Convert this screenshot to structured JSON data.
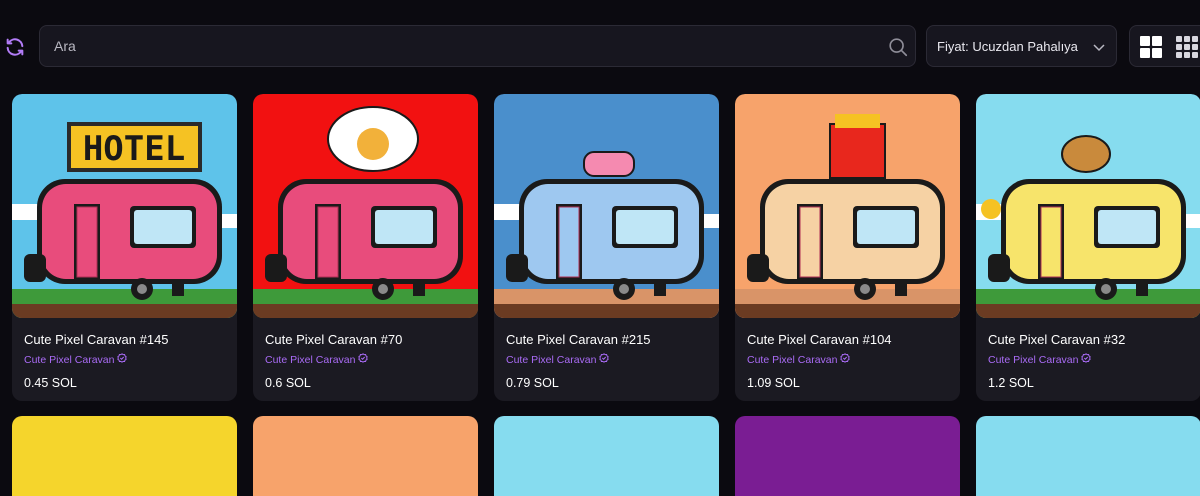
{
  "search": {
    "placeholder": "Ara",
    "value": ""
  },
  "sort": {
    "selected": "Fiyat: Ucuzdan Pahalıya"
  },
  "icons": {
    "refresh": "refresh-icon",
    "search": "search-icon",
    "chevron": "chevron-down-icon",
    "view_large": "grid-2x2-icon",
    "view_small": "grid-3x3-icon",
    "verified": "verified-badge-icon"
  },
  "colors": {
    "accent": "#a96bf5",
    "background": "#0b0a10",
    "card": "#1b1a22"
  },
  "items": [
    {
      "name": "Cute Pixel Caravan #145",
      "collection": "Cute Pixel Caravan",
      "price": "0.45 SOL",
      "bg": "#5ec3ea",
      "body": "#e84c7c",
      "sign": "HOTEL"
    },
    {
      "name": "Cute Pixel Caravan #70",
      "collection": "Cute Pixel Caravan",
      "price": "0.6 SOL",
      "bg": "#f21111",
      "body": "#e84c7c",
      "sign": ""
    },
    {
      "name": "Cute Pixel Caravan #215",
      "collection": "Cute Pixel Caravan",
      "price": "0.79 SOL",
      "bg": "#4a8fcc",
      "body": "#9ec8f0",
      "sign": ""
    },
    {
      "name": "Cute Pixel Caravan #104",
      "collection": "Cute Pixel Caravan",
      "price": "1.09 SOL",
      "bg": "#f7a36b",
      "body": "#f6d2a4",
      "sign": ""
    },
    {
      "name": "Cute Pixel Caravan #32",
      "collection": "Cute Pixel Caravan",
      "price": "1.2 SOL",
      "bg": "#86dcef",
      "body": "#f7e46b",
      "sign": ""
    }
  ],
  "row2_backgrounds": [
    "#f5d52c",
    "#f7a36b",
    "#86dcef",
    "#7a1d93",
    "#86dcef"
  ]
}
